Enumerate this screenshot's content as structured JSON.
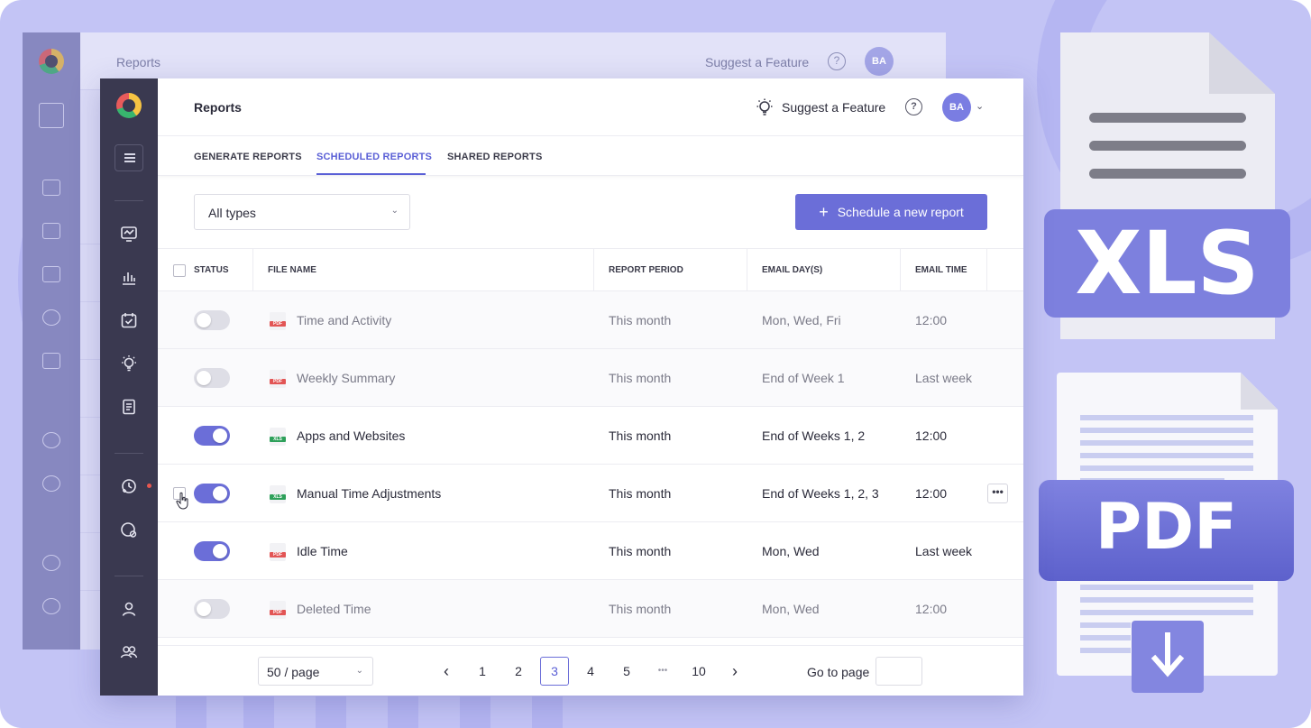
{
  "app": {
    "title": "Reports",
    "suggest_feature": "Suggest a Feature",
    "help_label": "?",
    "avatar_initials": "BA",
    "accent_color": "#6b6ed8",
    "sidebar_icons": [
      "menu-icon",
      "dashboard-icon",
      "chart-icon",
      "calendar-icon",
      "bulb-icon",
      "document-icon",
      "add-time-icon",
      "clock-off-icon",
      "user-icon",
      "users-icon"
    ]
  },
  "tabs": [
    {
      "label": "GENERATE REPORTS",
      "active": false
    },
    {
      "label": "SCHEDULED REPORTS",
      "active": true
    },
    {
      "label": "SHARED REPORTS",
      "active": false
    }
  ],
  "filter": {
    "value": "All types"
  },
  "schedule_button": {
    "label": "Schedule a new report"
  },
  "table": {
    "headers": {
      "status": "STATUS",
      "file_name": "FILE NAME",
      "report_period": "REPORT PERIOD",
      "email_days": "EMAIL DAY(S)",
      "email_time": "EMAIL TIME"
    },
    "rows": [
      {
        "enabled": false,
        "format": "PDF",
        "file_name": "Time and Activity",
        "period": "This month",
        "days": "Mon, Wed, Fri",
        "time": "12:00"
      },
      {
        "enabled": false,
        "format": "PDF",
        "file_name": "Weekly Summary",
        "period": "This month",
        "days": "End of Week 1",
        "time": "Last week"
      },
      {
        "enabled": true,
        "format": "XLS",
        "file_name": "Apps and Websites",
        "period": "This month",
        "days": "End of Weeks 1, 2",
        "time": "12:00"
      },
      {
        "enabled": true,
        "format": "XLS",
        "file_name": "Manual Time Adjustments",
        "period": "This month",
        "days": "End of Weeks 1, 2, 3",
        "time": "12:00"
      },
      {
        "enabled": true,
        "format": "PDF",
        "file_name": "Idle Time",
        "period": "This month",
        "days": "Mon, Wed",
        "time": "Last week"
      },
      {
        "enabled": false,
        "format": "PDF",
        "file_name": "Deleted Time",
        "period": "This month",
        "days": "Mon, Wed",
        "time": "12:00"
      }
    ],
    "more_label": "•••"
  },
  "pagination": {
    "per_page": "50 / page",
    "prev": "‹",
    "next": "›",
    "pages": [
      "1",
      "2",
      "3",
      "4",
      "5",
      "•••",
      "10"
    ],
    "current": "3",
    "goto_label": "Go to page"
  },
  "decor": {
    "xls_badge": "XLS",
    "pdf_badge": "PDF",
    "download_icon": "download-arrow-icon"
  }
}
